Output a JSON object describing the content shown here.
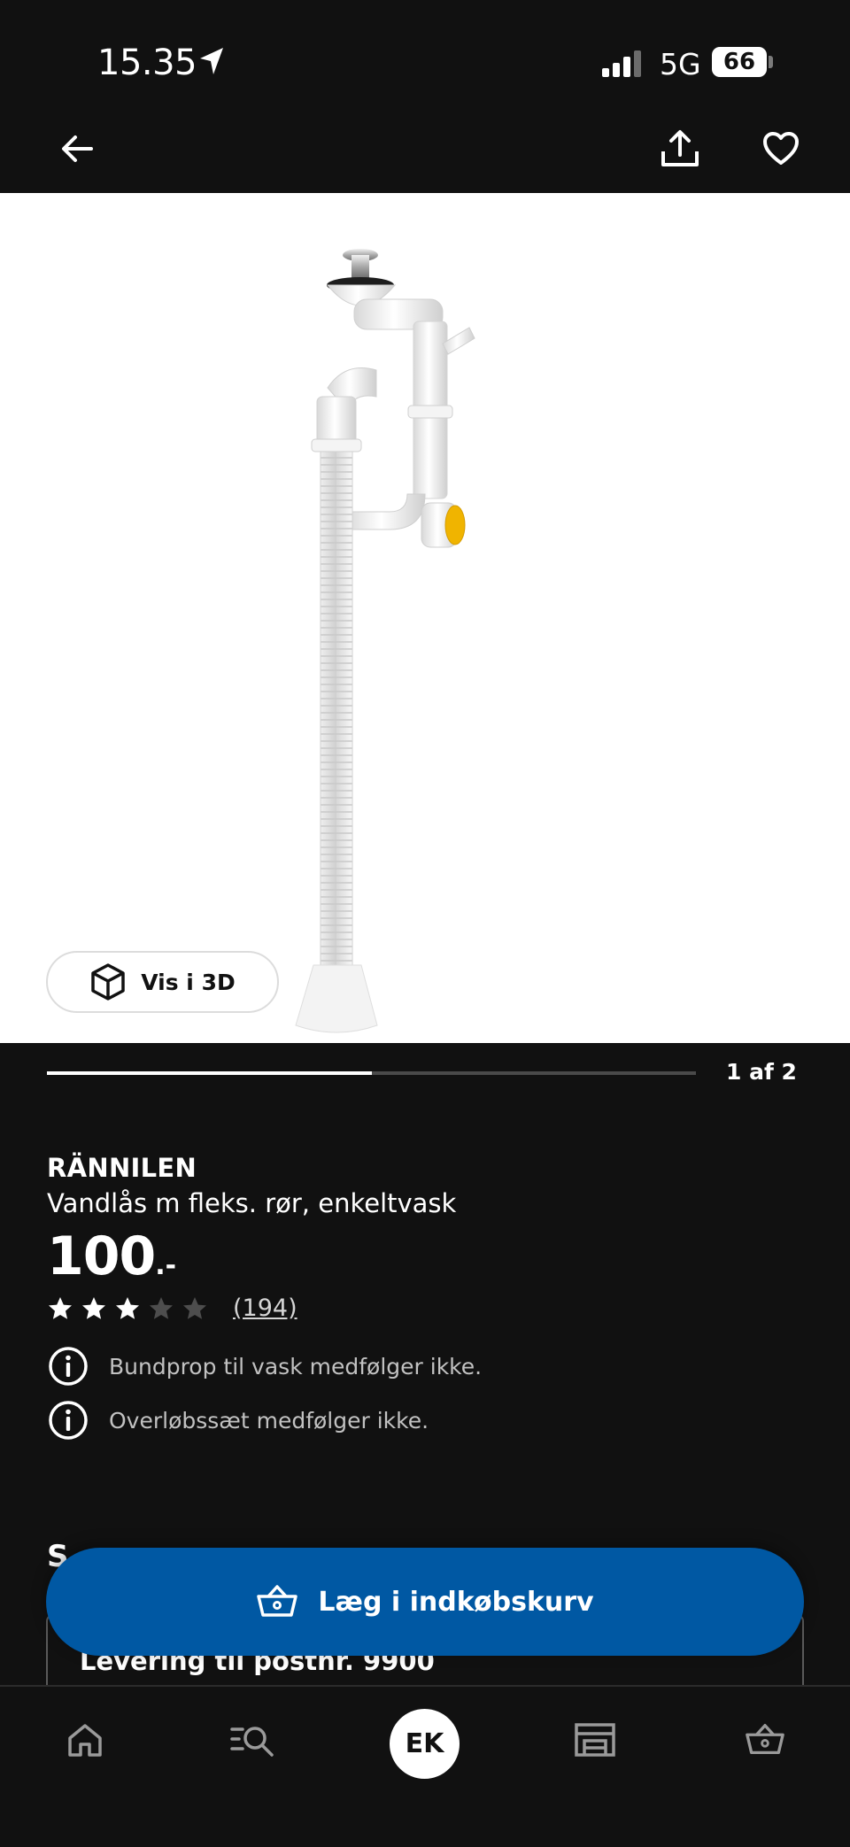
{
  "status_bar": {
    "time": "15.35",
    "network": "5G",
    "battery": "66"
  },
  "nav": {
    "back_icon": "arrow-left-icon",
    "share_icon": "share-icon",
    "favorite_icon": "heart-icon"
  },
  "gallery": {
    "view_3d_label": "Vis i 3D",
    "page_counter": "1 af 2",
    "progress_fraction": 0.5
  },
  "product": {
    "brand": "RÄNNILEN",
    "description": "Vandlås m fleks. rør, enkeltvask",
    "price": "100",
    "price_suffix": ".-",
    "rating_filled_stars": 3,
    "rating_max_stars": 5,
    "review_count": "(194)",
    "notes": [
      {
        "icon": "info-icon",
        "text": "Bundprop til vask medfølger ikke."
      },
      {
        "icon": "info-icon",
        "text": "Overløbssæt medfølger ikke."
      }
    ]
  },
  "delivery": {
    "card_title": "Levering til postnr. 9900"
  },
  "cta": {
    "label": "Læg i indkøbskurv",
    "icon": "basket-icon",
    "color": "#0058a3"
  },
  "tab_bar": {
    "avatar_initials": "EK",
    "tabs": [
      "home-icon",
      "search-list-icon",
      "profile-avatar",
      "store-icon",
      "basket-icon"
    ]
  }
}
